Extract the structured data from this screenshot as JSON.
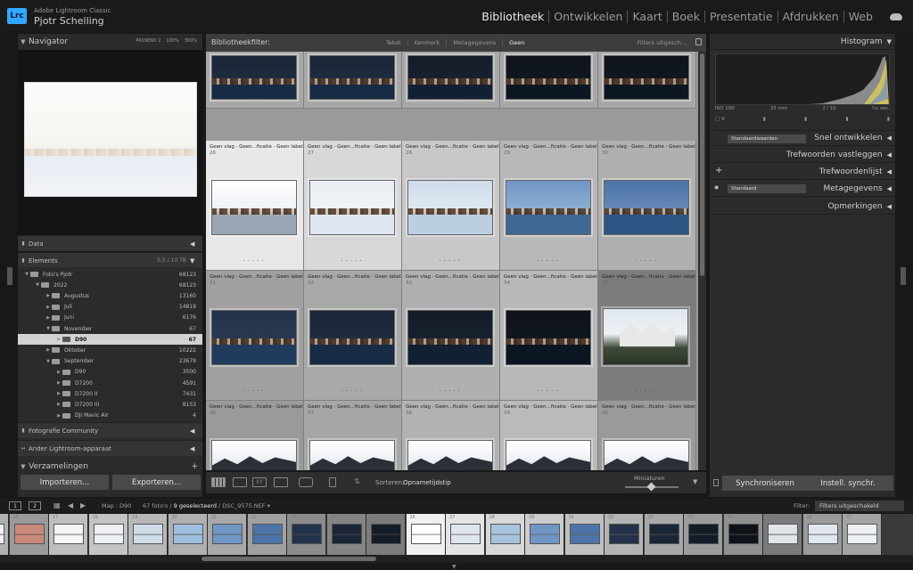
{
  "app": {
    "name": "Adobe Lightroom Classic",
    "user": "Pjotr Schelling",
    "logo": "Lrc",
    "modules": [
      "Bibliotheek",
      "Ontwikkelen",
      "Kaart",
      "Boek",
      "Presentatie",
      "Afdrukken",
      "Web"
    ],
    "active_module": "Bibliotheek"
  },
  "left_panel": {
    "navigator": {
      "title": "Navigator",
      "zoom": [
        "PASSEND 2",
        "100%",
        "300%"
      ]
    },
    "sections": {
      "data": "Data",
      "elements": "Elements",
      "elements_size": "5,5 / 10 TB",
      "community": "Fotografie Community",
      "other": "Ander Lightroom-apparaat",
      "collections": "Verzamelingen"
    },
    "folders": [
      {
        "name": "Foto's Pjotr",
        "count": "68123",
        "depth": 0,
        "open": true
      },
      {
        "name": "2022",
        "count": "68123",
        "depth": 1,
        "open": true
      },
      {
        "name": "Augustus",
        "count": "13160",
        "depth": 2
      },
      {
        "name": "Juli",
        "count": "14819",
        "depth": 2
      },
      {
        "name": "Juni",
        "count": "6176",
        "depth": 2
      },
      {
        "name": "November",
        "count": "67",
        "depth": 2,
        "open": true
      },
      {
        "name": "D90",
        "count": "67",
        "depth": 3,
        "selected": true
      },
      {
        "name": "Oktober",
        "count": "10222",
        "depth": 2
      },
      {
        "name": "September",
        "count": "23679",
        "depth": 2,
        "open": true
      },
      {
        "name": "D90",
        "count": "3500",
        "depth": 3
      },
      {
        "name": "D7200",
        "count": "4591",
        "depth": 3
      },
      {
        "name": "D7200 II",
        "count": "7431",
        "depth": 3
      },
      {
        "name": "D7200 III",
        "count": "8153",
        "depth": 3
      },
      {
        "name": "DJI Mavic Air",
        "count": "4",
        "depth": 3
      }
    ],
    "import_label": "Importeren...",
    "export_label": "Exporteren..."
  },
  "filter_bar": {
    "title": "Bibliotheekfilter:",
    "options": [
      "Tekst",
      "Kenmerk",
      "Metagegevens",
      "Geen"
    ],
    "active": "Geen",
    "filters_off": "Filters uitgesch..."
  },
  "grid": {
    "meta_text": "Geen vlag · Geen...ficatie · Geen label",
    "rows": [
      {
        "nums": [
          "",
          "",
          "",
          "",
          ""
        ],
        "partial": true
      },
      {
        "nums": [
          "26",
          "27",
          "28",
          "29",
          "30"
        ]
      },
      {
        "nums": [
          "31",
          "32",
          "33",
          "34",
          "35"
        ]
      },
      {
        "nums": [
          "36",
          "37",
          "38",
          "39",
          "40"
        ]
      }
    ]
  },
  "toolbar": {
    "sort_label": "Sorteren:",
    "sort_value": "Opnametijdstip",
    "thumbs_label": "Miniaturen"
  },
  "right_panel": {
    "histogram": "Histogram",
    "histo_info": [
      "ISO 100",
      "35 mm",
      "ƒ / 10",
      "¹⁄₄₀ sec."
    ],
    "histo_count": "9",
    "quick_develop": "Snel ontwikkelen",
    "quick_preset": "Standaardwaarden",
    "keywording": "Trefwoorden vastleggen",
    "keyword_list": "Trefwoordenlijst",
    "metadata": "Metagegevens",
    "metadata_preset": "Standaard",
    "comments": "Opmerkingen",
    "sync_label": "Synchroniseren",
    "sync_settings_label": "Instell. synchr."
  },
  "filmstrip_bar": {
    "screens": [
      "1",
      "2"
    ],
    "path": "Map : D90",
    "selection_a": "67 foto's / ",
    "selection_b": "9 geselecteerd",
    "selection_c": " / DSC_9575.NEF",
    "filter_label": "Filter:",
    "filter_value": "Filters uitgeschakeld"
  },
  "filmstrip": {
    "nums": [
      "",
      "16",
      "17",
      "18",
      "19",
      "20",
      "21",
      "22",
      "23",
      "24",
      "25",
      "26",
      "27",
      "28",
      "29",
      "30",
      "31",
      "32",
      "33",
      "34",
      "35",
      "36",
      "37"
    ]
  }
}
